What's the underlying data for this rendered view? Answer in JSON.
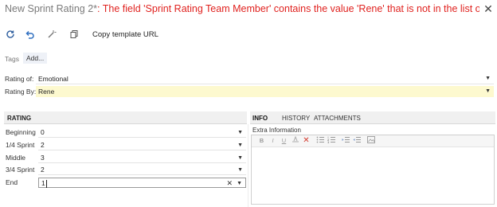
{
  "header": {
    "form_name": "New Sprint Rating 2*",
    "error_message": ": The field 'Sprint Rating Team Member' contains the value 'Rene' that is not in the list of supp..."
  },
  "toolbar": {
    "copy_template_url": "Copy template URL",
    "icons": [
      "refresh-icon",
      "undo-icon",
      "actions-icon",
      "copy-icon"
    ]
  },
  "tags": {
    "label": "Tags",
    "add": "Add..."
  },
  "fields": {
    "rating_of": {
      "label": "Rating of:",
      "value": "Emotional"
    },
    "rating_by": {
      "label": "Rating By:",
      "value": "Rene"
    }
  },
  "rating": {
    "header": "RATING",
    "rows": [
      {
        "label": "Beginning",
        "value": "0"
      },
      {
        "label": "1/4 Sprint",
        "value": "2"
      },
      {
        "label": "Middle",
        "value": "3"
      },
      {
        "label": "3/4 Sprint",
        "value": "2"
      },
      {
        "label": "End",
        "value": "1"
      }
    ]
  },
  "tabs": [
    "INFO",
    "HISTORY",
    "ATTACHMENTS"
  ],
  "extra_info": {
    "label": "Extra Information",
    "editor_buttons": [
      "B",
      "I",
      "U"
    ]
  },
  "colors": {
    "error": "#e0221f",
    "highlight": "#fdf9cf",
    "icon_blue": "#3a6fb0"
  }
}
